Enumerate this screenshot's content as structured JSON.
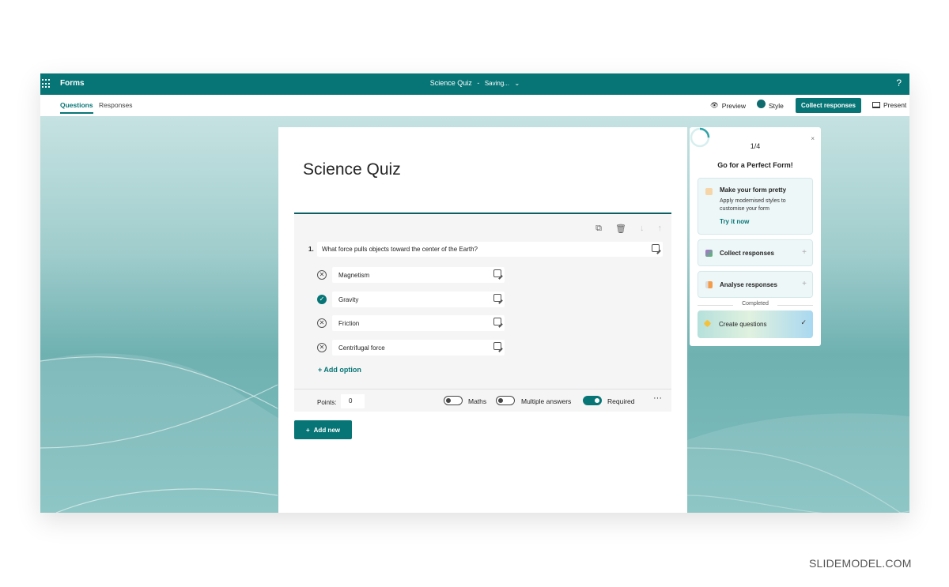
{
  "topbar": {
    "app_name": "Forms",
    "doc_title": "Science Quiz",
    "separator": "-",
    "save_status": "Saving...",
    "chevron": "⌄",
    "help": "?",
    "icons": {
      "launcher": "app-launcher-icon",
      "help": "help-icon"
    }
  },
  "nav": {
    "tabs": [
      {
        "label": "Questions",
        "active": true
      },
      {
        "label": "Responses",
        "active": false
      }
    ],
    "preview_label": "Preview",
    "style_label": "Style",
    "collect_label": "Collect responses",
    "present_label": "Present"
  },
  "form": {
    "title": "Science Quiz",
    "question": {
      "number": "1.",
      "text": "What force pulls objects toward the center of the Earth?",
      "tools": {
        "copy": "⧉",
        "delete": "🗑",
        "down": "↓",
        "up": "↑"
      },
      "options": [
        {
          "label": "Magnetism",
          "correct": false,
          "mark": "✕"
        },
        {
          "label": "Gravity",
          "correct": true,
          "mark": "✓"
        },
        {
          "label": "Friction",
          "correct": false,
          "mark": "✕"
        },
        {
          "label": "Centrifugal force",
          "correct": false,
          "mark": "✕"
        }
      ],
      "add_option_label": "+ Add option",
      "points_label": "Points:",
      "points_value": "0",
      "toggles": [
        {
          "label": "Maths",
          "on": false
        },
        {
          "label": "Multiple answers",
          "on": false
        },
        {
          "label": "Required",
          "on": true
        }
      ],
      "more": "···"
    },
    "add_new_label": "Add new",
    "add_new_icon": "+"
  },
  "panel": {
    "progress_text": "1/4",
    "progress_fraction": 0.25,
    "close": "×",
    "title": "Go for a Perfect Form!",
    "pretty": {
      "title": "Make your form pretty",
      "desc": "Apply modernised styles to customise your form",
      "link": "Try it now"
    },
    "collect": {
      "title": "Collect responses",
      "plus": "+"
    },
    "analyse": {
      "title": "Analyse responses",
      "plus": "+"
    },
    "completed_label": "Completed",
    "create": {
      "title": "Create questions",
      "check": "✓"
    }
  },
  "colors": {
    "brand": "#077576"
  },
  "watermark": "SLIDEMODEL.COM"
}
